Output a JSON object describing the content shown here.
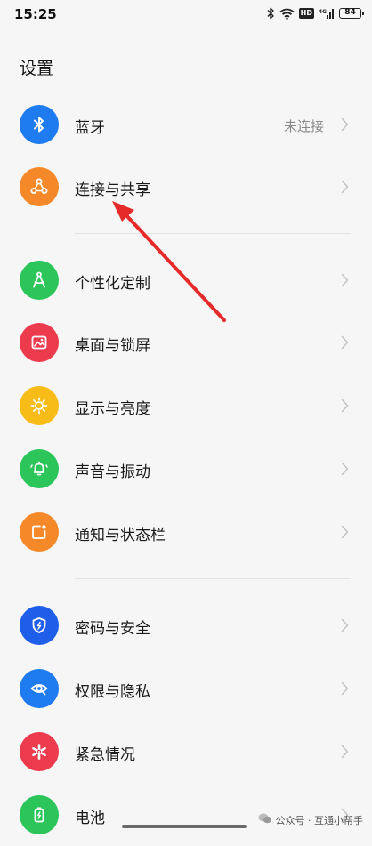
{
  "status_bar": {
    "time": "15:25",
    "battery": "84",
    "network_badge": "HD"
  },
  "page": {
    "title": "设置"
  },
  "items": [
    {
      "label": "蓝牙",
      "value": "未连接",
      "icon": "bluetooth-icon",
      "color": "#1e7bf0"
    },
    {
      "label": "连接与共享",
      "icon": "share-nodes-icon",
      "color": "#f5892a"
    },
    {
      "label": "个性化定制",
      "icon": "compass-draw-icon",
      "color": "#2cc55a"
    },
    {
      "label": "桌面与锁屏",
      "icon": "picture-icon",
      "color": "#ec3b4d"
    },
    {
      "label": "显示与亮度",
      "icon": "sun-icon",
      "color": "#f7bc18"
    },
    {
      "label": "声音与振动",
      "icon": "bell-vibrate-icon",
      "color": "#2cc55a"
    },
    {
      "label": "通知与状态栏",
      "icon": "notification-icon",
      "color": "#f5892a"
    },
    {
      "label": "密码与安全",
      "icon": "shield-icon",
      "color": "#1f5ee8"
    },
    {
      "label": "权限与隐私",
      "icon": "eye-privacy-icon",
      "color": "#1e7bf0"
    },
    {
      "label": "紧急情况",
      "icon": "emergency-icon",
      "color": "#ec3b4d"
    },
    {
      "label": "电池",
      "icon": "battery-icon",
      "color": "#2cc55a"
    }
  ],
  "annotation": {
    "arrow_color": "#e62a2a"
  },
  "watermark": {
    "text": "公众号 · 互通小帮手"
  }
}
